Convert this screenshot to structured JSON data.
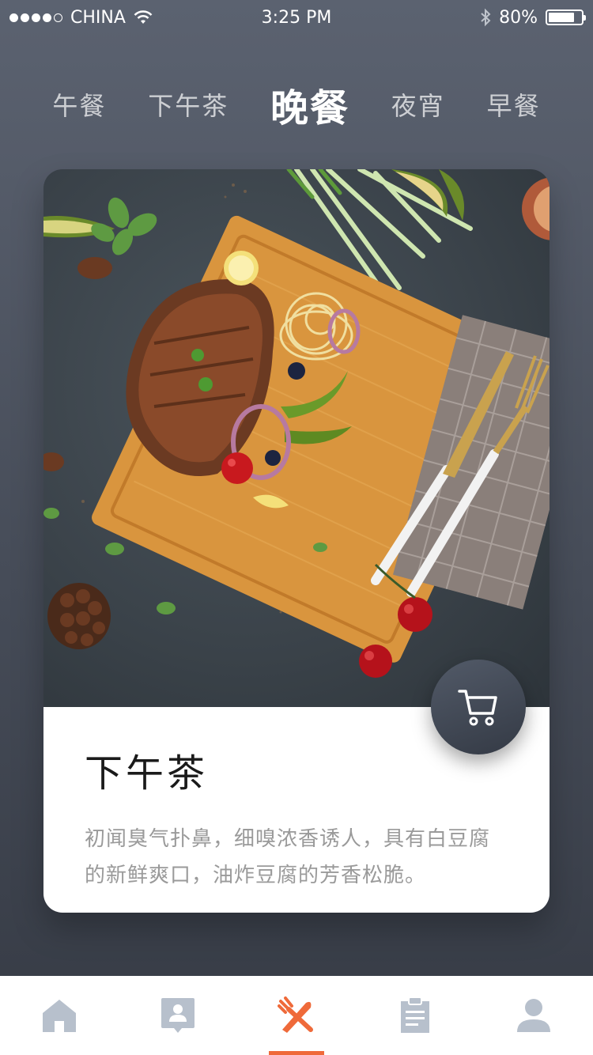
{
  "status_bar": {
    "carrier": "CHINA",
    "time": "3:25 PM",
    "battery": "80%",
    "battery_level": 0.8,
    "signal_icon": "signal-dots-icon",
    "wifi_icon": "wifi-icon",
    "bluetooth_icon": "bluetooth-icon"
  },
  "tabs": [
    {
      "label": "午餐",
      "active": false
    },
    {
      "label": "下午茶",
      "active": false
    },
    {
      "label": "晚餐",
      "active": true
    },
    {
      "label": "夜宵",
      "active": false
    },
    {
      "label": "早餐",
      "active": false
    }
  ],
  "card": {
    "title": "下午茶",
    "description": "初闻臭气扑鼻，细嗅浓香诱人，具有白豆腐的新鲜爽口，油炸豆腐的芳香松脆。",
    "cart_icon": "cart-icon"
  },
  "bottom_nav": [
    {
      "icon": "home-icon",
      "active": false
    },
    {
      "icon": "contact-card-icon",
      "active": false
    },
    {
      "icon": "fork-knife-icon",
      "active": true
    },
    {
      "icon": "clipboard-icon",
      "active": false
    },
    {
      "icon": "user-icon",
      "active": false
    }
  ],
  "colors": {
    "accent": "#ef6a3a",
    "nav_inactive": "#b7c0cc",
    "background_top": "#5b6270",
    "background_bottom": "#363b45"
  }
}
